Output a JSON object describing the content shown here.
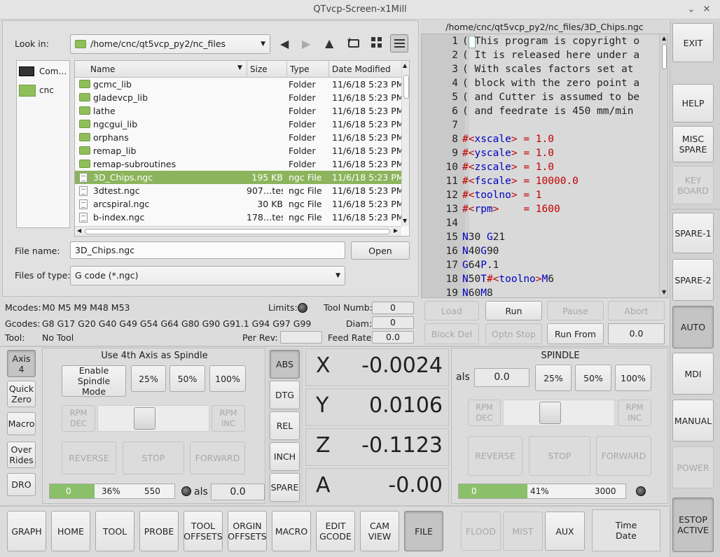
{
  "window": {
    "title": "QTvcp-Screen-x1Mill"
  },
  "file_dialog": {
    "look_in_label": "Look in:",
    "look_in_path": "/home/cnc/qt5vcp_py2/nc_files",
    "sidebar": [
      {
        "label": "Com…",
        "icon": "computer-icon"
      },
      {
        "label": "cnc",
        "icon": "folder-icon"
      }
    ],
    "columns": [
      "Name",
      "Size",
      "Type",
      "Date Modified"
    ],
    "rows": [
      {
        "name": "gcmc_lib",
        "size": "",
        "type": "Folder",
        "date": "11/6/18 5:23 PM",
        "kind": "folder"
      },
      {
        "name": "gladevcp_lib",
        "size": "",
        "type": "Folder",
        "date": "11/6/18 5:23 PM",
        "kind": "folder"
      },
      {
        "name": "lathe",
        "size": "",
        "type": "Folder",
        "date": "11/6/18 5:23 PM",
        "kind": "folder"
      },
      {
        "name": "ngcgui_lib",
        "size": "",
        "type": "Folder",
        "date": "11/6/18 5:23 PM",
        "kind": "folder"
      },
      {
        "name": "orphans",
        "size": "",
        "type": "Folder",
        "date": "11/6/18 5:23 PM",
        "kind": "folder"
      },
      {
        "name": "remap_lib",
        "size": "",
        "type": "Folder",
        "date": "11/6/18 5:23 PM",
        "kind": "folder"
      },
      {
        "name": "remap-subroutines",
        "size": "",
        "type": "Folder",
        "date": "11/6/18 5:23 PM",
        "kind": "folder"
      },
      {
        "name": "3D_Chips.ngc",
        "size": "195 KB",
        "type": "ngc File",
        "date": "11/6/18 5:23 PM",
        "kind": "file"
      },
      {
        "name": "3dtest.ngc",
        "size": "907…tes",
        "type": "ngc File",
        "date": "11/6/18 5:23 PM",
        "kind": "file"
      },
      {
        "name": "arcspiral.ngc",
        "size": "30 KB",
        "type": "ngc File",
        "date": "11/6/18 5:23 PM",
        "kind": "file"
      },
      {
        "name": "b-index.ngc",
        "size": "178…tes",
        "type": "ngc File",
        "date": "11/6/18 5:23 PM",
        "kind": "file"
      }
    ],
    "selected_row": 7,
    "file_name_label": "File name:",
    "file_name_value": "3D_Chips.ngc",
    "open_button": "Open",
    "files_of_type_label": "Files of type:",
    "files_of_type_value": "G code (*.ngc)"
  },
  "gcode": {
    "path": "/home/cnc/qt5vcp_py2/nc_files/3D_Chips.ngc",
    "lines": [
      {
        "n": "1",
        "text": "( This program is copyright o"
      },
      {
        "n": "2",
        "text": "( It is released here under a"
      },
      {
        "n": "3",
        "text": "( With scales factors set at"
      },
      {
        "n": "4",
        "text": "( block with the zero point a"
      },
      {
        "n": "5",
        "text": "( and Cutter is assumed to be"
      },
      {
        "n": "6",
        "text": "( and feedrate is 450 mm/min"
      },
      {
        "n": "7",
        "text": ""
      },
      {
        "n": "8",
        "text": "#<xscale> = 1.0"
      },
      {
        "n": "9",
        "text": "#<yscale> = 1.0"
      },
      {
        "n": "10",
        "text": "#<zscale> = 1.0"
      },
      {
        "n": "11",
        "text": "#<fscale> = 10000.0"
      },
      {
        "n": "12",
        "text": "#<toolno> = 1"
      },
      {
        "n": "13",
        "text": "#<rpm>    = 1600"
      },
      {
        "n": "14",
        "text": ""
      },
      {
        "n": "15",
        "text": "N30 G21"
      },
      {
        "n": "16",
        "text": "N40G90"
      },
      {
        "n": "17",
        "text": "G64P.1"
      },
      {
        "n": "18",
        "text": "N50T#<toolno>M6"
      },
      {
        "n": "19",
        "text": "N60M8"
      }
    ],
    "buttons": {
      "load": "Load",
      "run": "Run",
      "pause": "Pause",
      "abort": "Abort",
      "block_del": "Block Del",
      "optn_stop": "Optn Stop",
      "run_from": "Run From",
      "run_from_value": "0.0"
    }
  },
  "status": {
    "mcodes_label": "Mcodes:",
    "mcodes": "M0 M5 M9 M48 M53",
    "gcodes_label": "Gcodes:",
    "gcodes": "G8 G17 G20 G40 G49 G54 G64 G80 G90 G91.1 G94 G97 G99",
    "tool_label": "Tool:",
    "tool": "No Tool",
    "limits_label": "Limits:",
    "tool_numb_label": "Tool Numb:",
    "tool_numb": "0",
    "diam_label": "Diam:",
    "diam": "0",
    "per_rev_label": "Per Rev:",
    "per_rev": "",
    "feed_rate_label": "Feed Rate:",
    "feed_rate": "0.0"
  },
  "left_tabs": [
    {
      "label": "Axis\n4",
      "on": true
    },
    {
      "label": "Quick\nZero",
      "on": false
    },
    {
      "label": "Macro",
      "on": false
    },
    {
      "label": "Over\nRides",
      "on": false
    },
    {
      "label": "DRO",
      "on": false
    }
  ],
  "axis4_spindle": {
    "title": "Use 4th Axis as Spindle",
    "enable": "Enable Spindle\nMode",
    "p25": "25%",
    "p50": "50%",
    "p100": "100%",
    "rpm_dec": "RPM\nDEC",
    "rpm_inc": "RPM\nINC",
    "slider_level": 0.4,
    "reverse": "REVERSE",
    "stop": "STOP",
    "forward": "FORWARD",
    "bar_left": "0",
    "bar_pct": "36%",
    "bar_right": "550",
    "bar_fraction": 0.36,
    "als_label": "als",
    "als_value": "0.0"
  },
  "dro_buttons": [
    "ABS",
    "DTG",
    "REL",
    "INCH",
    "SPARE"
  ],
  "dro": [
    {
      "axis": "X",
      "value": "-0.0024"
    },
    {
      "axis": "Y",
      "value": "0.0106"
    },
    {
      "axis": "Z",
      "value": "-0.1123"
    },
    {
      "axis": "A",
      "value": "-0.00"
    }
  ],
  "spindle": {
    "title": "SPINDLE",
    "als_label": "als",
    "als_value": "0.0",
    "p25": "25%",
    "p50": "50%",
    "p100": "100%",
    "rpm_dec": "RPM\nDEC",
    "rpm_inc": "RPM\nINC",
    "slider_level": 0.4,
    "reverse": "REVERSE",
    "stop": "STOP",
    "forward": "FORWARD",
    "bar_left": "0",
    "bar_pct": "41%",
    "bar_right": "3000",
    "bar_fraction": 0.41
  },
  "right_column": {
    "exit": "EXIT",
    "help": "HELP",
    "misc_spare": "MISC\nSPARE",
    "keyboard": "KEY\nBOARD",
    "spare1": "SPARE-1",
    "spare2": "SPARE-2",
    "auto": "AUTO",
    "mdi": "MDI",
    "manual": "MANUAL",
    "power": "POWER",
    "estop": "ESTOP\nACTIVE"
  },
  "bottom_tabs": [
    {
      "label": "GRAPH",
      "on": false
    },
    {
      "label": "HOME",
      "on": false
    },
    {
      "label": "TOOL",
      "on": false
    },
    {
      "label": "PROBE",
      "on": false
    },
    {
      "label": "TOOL\nOFFSETS",
      "on": false
    },
    {
      "label": "ORGIN\nOFFSETS",
      "on": false
    },
    {
      "label": "MACRO",
      "on": false
    },
    {
      "label": "EDIT\nGCODE",
      "on": false
    },
    {
      "label": "CAM\nVIEW",
      "on": false
    },
    {
      "label": "FILE",
      "on": true
    }
  ],
  "coolant": {
    "flood": "FLOOD",
    "mist": "MIST",
    "aux": "AUX",
    "time_date": "Time\nDate"
  },
  "colors": {
    "selection": "#8cb45c",
    "bar_fill": "#8bc06a",
    "gcode_keyword": "#0000c0",
    "gcode_var": "#c00000"
  }
}
